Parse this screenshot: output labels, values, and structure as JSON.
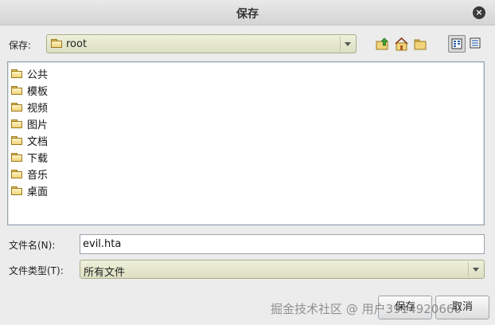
{
  "window": {
    "title": "保存",
    "close_glyph": "×"
  },
  "save_in": {
    "label": "保存:",
    "value": "root"
  },
  "toolbar": {
    "icons": [
      "up-folder-icon",
      "home-folder-icon",
      "new-folder-icon",
      "list-view-icon",
      "details-view-icon"
    ]
  },
  "files": [
    {
      "name": "公共"
    },
    {
      "name": "模板"
    },
    {
      "name": "视频"
    },
    {
      "name": "图片"
    },
    {
      "name": "文档"
    },
    {
      "name": "下载"
    },
    {
      "name": "音乐"
    },
    {
      "name": "桌面"
    }
  ],
  "file_name": {
    "label": "文件名(N):",
    "value": "evil.hta"
  },
  "file_type": {
    "label": "文件类型(T):",
    "value": "所有文件"
  },
  "buttons": {
    "save": "保存",
    "cancel": "取消"
  },
  "watermark": "掘金技术社区 @ 用户3914920660",
  "colors": {
    "folder": "#f1d37a",
    "combo_bg": "#dcdfc2"
  }
}
